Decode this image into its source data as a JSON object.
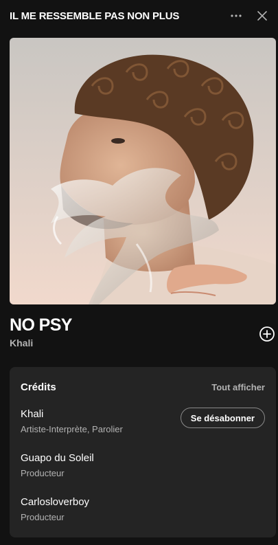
{
  "header": {
    "title": "IL ME RESSEMBLE PAS NON PLUS",
    "more_icon": "more-horizontal-icon",
    "close_icon": "close-icon"
  },
  "cover": {
    "bg_top": "#c9c6c2",
    "bg_bottom": "#f1d9cc"
  },
  "track": {
    "title": "NO PSY",
    "artist": "Khali",
    "add_icon": "add-circle-icon"
  },
  "credits": {
    "heading": "Crédits",
    "show_all": "Tout afficher",
    "items": [
      {
        "name": "Khali",
        "role": "Artiste-Interprète, Parolier",
        "action": "Se désabonner"
      },
      {
        "name": "Guapo du Soleil",
        "role": "Producteur"
      },
      {
        "name": "Carlosloverboy",
        "role": "Producteur"
      }
    ]
  },
  "colors": {
    "background": "#121212",
    "card": "#242424",
    "text_primary": "#ffffff",
    "text_secondary": "#b3b3b3"
  }
}
